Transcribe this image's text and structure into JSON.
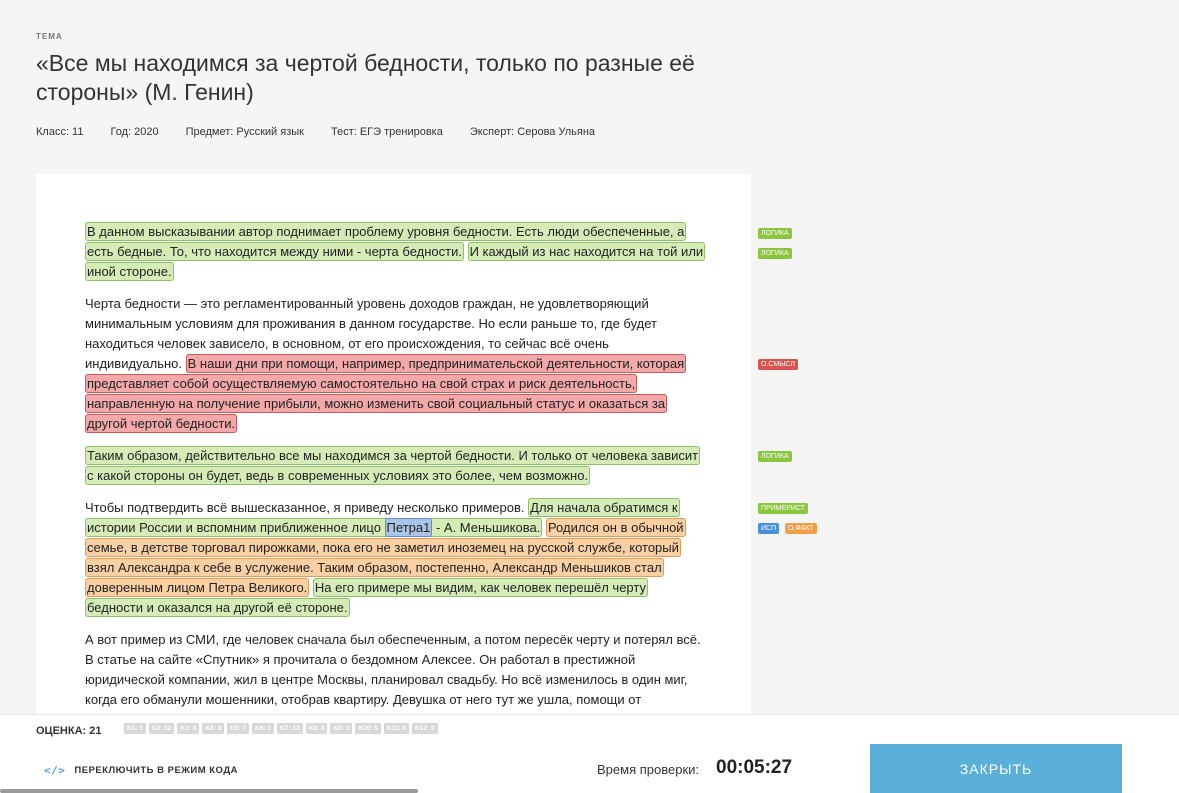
{
  "header": {
    "topic_label": "ТЕМА",
    "title": "«Все мы находимся за чертой бедности, только по разные её стороны» (М. Генин)",
    "meta": {
      "class": "Класс: 11",
      "year": "Год: 2020",
      "subject": "Предмет: Русский язык",
      "test": "Тест: ЕГЭ тренировка",
      "expert": "Эксперт: Серова Ульяна"
    }
  },
  "essay": {
    "p1": {
      "s1": "В данном высказывании автор поднимает проблему уровня бедности. Есть люди обеспеченные, а есть бедные. То, что находится между ними - черта бедности.",
      "s2": "И каждый из нас находится на той или иной стороне."
    },
    "p2": {
      "plain": "Черта бедности — это регламентированный уровень доходов граждан, не удовлетворяющий минимальным условиям для проживания в данном государстве. Но если раньше то, где будет находиться человек зависело, в основном, от его происхождения, то сейчас всё очень индивидуально. ",
      "red": "В наши дни при помощи, например, предпринимательской деятельности, которая представляет собой осуществляемую самостоятельно на свой страх и риск деятельность, направленную на получение прибыли, можно изменить свой социальный статус и оказаться за другой чертой бедности."
    },
    "p3": {
      "green": "Таким образом, действительно все мы находимся за чертой бедности. И только от человека зависит с какой стороны он будет, ведь в современных условиях это более, чем возможно."
    },
    "p4": {
      "plain": "Чтобы подтвердить всё вышесказанное, я приведу несколько примеров. ",
      "green1a": "Для начала обратимся к истории России и вспомним приближенное лицо ",
      "blue": "Петра1",
      "green1b": " - А. Меньшикова.",
      "orange": "Родился он в обычной семье, в детстве торговал пирожками, пока его не заметил иноземец на русской службе, который взял Александра к себе в услужение. Таким образом, постепенно, Александр Меньшиков стал доверенным лицом Петра Великого.",
      "green2": "На его примере мы видим, как человек перешёл черту бедности и оказался на другой её стороне."
    },
    "p5": {
      "plain": "А вот пример из СМИ, где человек сначала был обеспеченным, а потом пересёк черту и потерял всё. В статье на сайте «Спутник» я прочитала о бездомном Алексее. Он работал в престижной юридической компании, жил в центре Москвы, планировал свадьбу. Но всё изменилось в один миг, когда его обманули мошенники, отобрав квартиру. Девушка от него тут же ушла, помощи от родственников он тоже не дождался. Сейчас он живёт на улице и Алексей совсем не знает, что делать дальше."
    }
  },
  "tags": {
    "t1": "ЛОГИКА",
    "t2": "ЛОГИКА",
    "t3": "О.СМЫСЛ",
    "t4": "ЛОГИКА",
    "t5": "ПРИМЕРИСТ",
    "t6": "ИСП",
    "t7": "О.ФАКТ"
  },
  "footer": {
    "score": "ОЦЕНКА: 21",
    "criteria": [
      "K1: 1",
      "K2: 12",
      "K3: 0",
      "K4: 8",
      "K5: 7",
      "K6: 3",
      "K7: 12",
      "K8: 0",
      "K9: 3",
      "K10: 5",
      "K11: 9",
      "K12: 0"
    ],
    "code_icon": "</>",
    "code_switch": "ПЕРЕКЛЮЧИТЬ В РЕЖИМ КОДА",
    "timer_label": "Время проверки:",
    "timer": "00:05:27",
    "close": "ЗАКРЫТЬ"
  }
}
